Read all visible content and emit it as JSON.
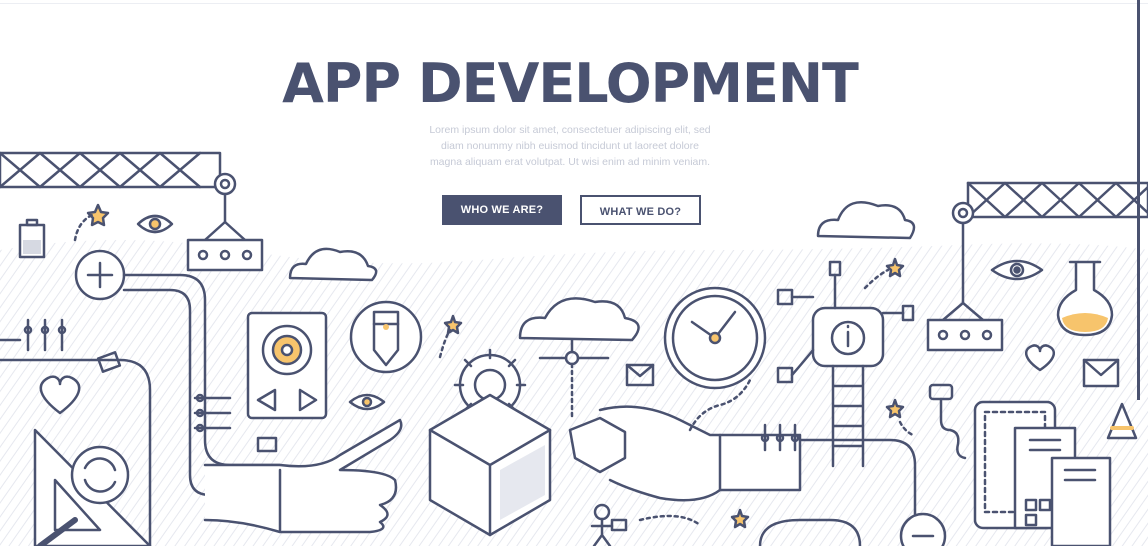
{
  "hero": {
    "title": "APP DEVELOPMENT",
    "description": [
      "Lorem ipsum dolor sit amet, consectetuer adipiscing elit, sed",
      "diam nonummy nibh euismod tincidunt ut laoreet dolore",
      "magna aliquam erat volutpat. Ut wisi enim ad minim veniam."
    ]
  },
  "buttons": {
    "primary_label": "WHO WE ARE?",
    "secondary_label": "WHAT WE DO?"
  },
  "colors": {
    "ink": "#4a5270",
    "accent": "#f7c46c",
    "line": "#4a5270",
    "hatch": "#e6e8ef"
  },
  "illustration": {
    "icons": [
      "crane-icon",
      "star-icon",
      "eye-icon",
      "battery-icon",
      "plus-icon",
      "cloud-icon",
      "speaker-icon",
      "pencil-icon",
      "cloud-network-icon",
      "clock-icon",
      "info-robot-icon",
      "ladder-icon",
      "flask-icon",
      "heart-icon",
      "mail-icon",
      "gear-icon",
      "cube-icon",
      "hand-pointing-icon",
      "refresh-icon",
      "triangle-ruler-icon",
      "mobile-device-icon",
      "cone-icon",
      "plug-icon",
      "person-icon"
    ]
  }
}
